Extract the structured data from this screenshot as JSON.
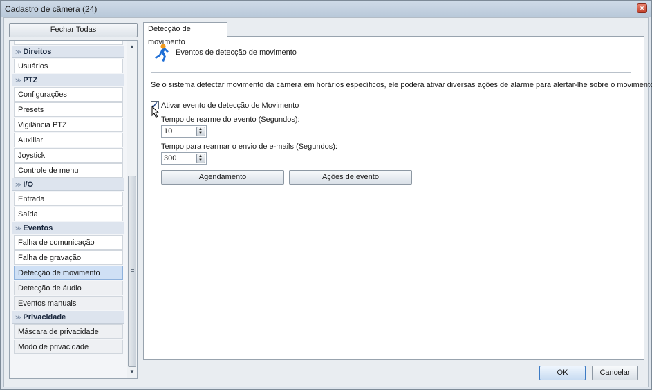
{
  "window": {
    "title": "Cadastro de câmera (24)",
    "close_glyph": "×"
  },
  "sidebar": {
    "close_all_label": "Fechar Todas",
    "categories": [
      {
        "label": "Direitos",
        "items": [
          {
            "label": "Usuários"
          }
        ]
      },
      {
        "label": "PTZ",
        "items": [
          {
            "label": "Configurações"
          },
          {
            "label": "Presets"
          },
          {
            "label": "Vigilância PTZ"
          },
          {
            "label": "Auxiliar"
          },
          {
            "label": "Joystick"
          },
          {
            "label": "Controle de menu"
          }
        ]
      },
      {
        "label": "I/O",
        "items": [
          {
            "label": "Entrada"
          },
          {
            "label": "Saída"
          }
        ]
      },
      {
        "label": "Eventos",
        "items": [
          {
            "label": "Falha de comunicação"
          },
          {
            "label": "Falha de gravação"
          },
          {
            "label": "Detecção de movimento"
          },
          {
            "label": "Detecção de áudio"
          },
          {
            "label": "Eventos manuais"
          }
        ]
      },
      {
        "label": "Privacidade",
        "items": [
          {
            "label": "Máscara de privacidade"
          },
          {
            "label": "Modo de privacidade"
          }
        ]
      }
    ],
    "selected": "Detecção de movimento"
  },
  "tab": {
    "label": "Detecção de movimento"
  },
  "panel": {
    "header": "Eventos de detecção de movimento",
    "description": "Se o sistema detectar movimento da câmera em horários específicos, ele poderá ativar diversas ações de alarme para alertar-lhe sobre o movimento",
    "enable_checkbox": {
      "label": "Ativar evento de detecção de Movimento",
      "checked": true
    },
    "rearm_time": {
      "label": "Tempo de rearme do evento (Segundos):",
      "value": "10"
    },
    "email_rearm_time": {
      "label": "Tempo para rearmar o envio de e-mails (Segundos):",
      "value": "300"
    },
    "schedule_button": "Agendamento",
    "event_actions_button": "Ações de evento"
  },
  "footer": {
    "ok_label": "OK",
    "cancel_label": "Cancelar"
  },
  "colors": {
    "accent": "#3d7bc4",
    "selected_row": "#cfe0f5",
    "icon_blue": "#1f6fd6",
    "icon_orange": "#f29a1c"
  },
  "icons": {
    "event_icon": "running-person-icon",
    "category_chevron": "chevron-double-down-icon"
  }
}
